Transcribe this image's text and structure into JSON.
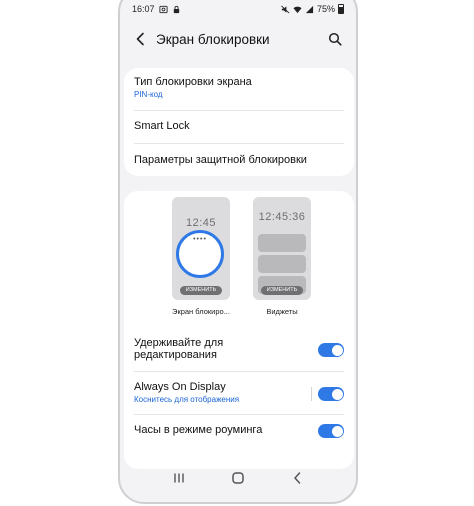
{
  "status_bar": {
    "time": "16:07",
    "battery": "75%"
  },
  "header": {
    "title": "Экран блокировки"
  },
  "settings": {
    "lock_type": {
      "title": "Тип блокировки экрана",
      "value": "PIN-код"
    },
    "smart_lock": {
      "title": "Smart Lock"
    },
    "secure_lock": {
      "title": "Параметры защитной блокировки"
    }
  },
  "previews": {
    "lock": {
      "time": "12:45",
      "edit_label": "ИЗМЕНИТЬ",
      "caption": "Экран блокиро..."
    },
    "widgets": {
      "time": "12:45:36",
      "edit_label": "ИЗМЕНИТЬ",
      "caption": "Виджеты"
    }
  },
  "toggles": {
    "hold_to_edit": {
      "title": "Удерживайте для редактирования",
      "line1": "Удерживайте для",
      "line2": "редактирования",
      "on": true
    },
    "always_on_display": {
      "title": "Always On Display",
      "subtitle": "Коснитесь для отображения",
      "on": true
    },
    "roaming_clock": {
      "title": "Часы в режиме роуминга",
      "on": true
    }
  },
  "colors": {
    "accent": "#2f79e6",
    "link": "#1a64d6",
    "background": "#f3f3f5",
    "card": "#ffffff"
  },
  "icons": {
    "back": "chevron-left-icon",
    "search": "search-icon",
    "nav_recents": "recents-icon",
    "nav_home": "home-icon",
    "nav_back": "back-icon"
  }
}
